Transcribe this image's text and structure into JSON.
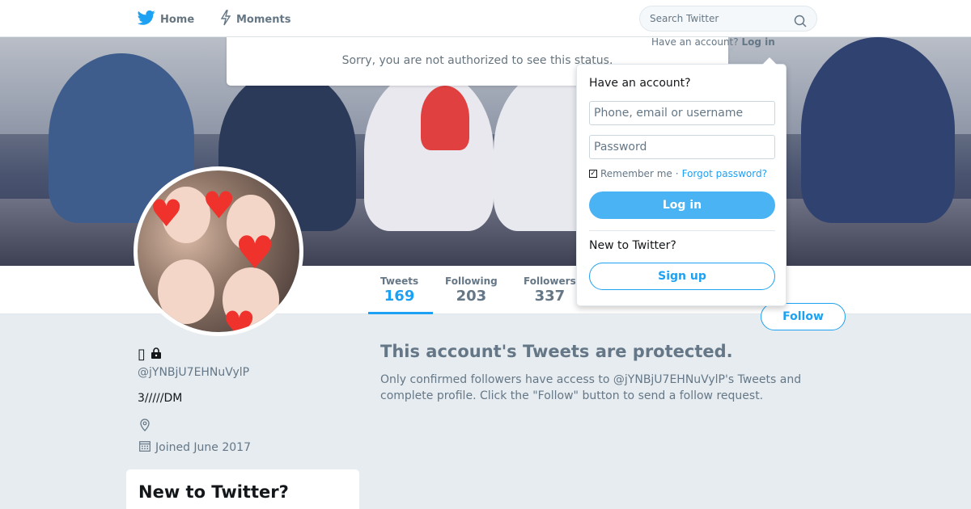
{
  "nav": {
    "home_label": "Home",
    "moments_label": "Moments",
    "search_placeholder": "Search Twitter"
  },
  "error": {
    "message": "Sorry, you are not authorized to see this status."
  },
  "profile": {
    "name_glyphs": "▯",
    "handle": "@jYNBjU7EHNuVylP",
    "bio": "3/////DM",
    "joined": "Joined June 2017",
    "stats": [
      {
        "label": "Tweets",
        "value": "169"
      },
      {
        "label": "Following",
        "value": "203"
      },
      {
        "label": "Followers",
        "value": "337"
      }
    ],
    "follow_label": "Follow"
  },
  "protected": {
    "title": "This account's Tweets are protected.",
    "text": "Only confirmed followers have access to @jYNBjU7EHNuVylP's Tweets and complete profile. Click the \"Follow\" button to send a follow request."
  },
  "sidebar": {
    "signup_heading": "New to Twitter?"
  },
  "login": {
    "have_account_text": "Have an account?",
    "have_account_link": "Log in",
    "heading": "Have an account?",
    "username_placeholder": "Phone, email or username",
    "password_placeholder": "Password",
    "remember_label": "Remember me",
    "separator": "·",
    "forgot_label": "Forgot password?",
    "login_button": "Log in",
    "new_heading": "New to Twitter?",
    "signup_button": "Sign up"
  },
  "colors": {
    "brand": "#1da1f2",
    "background": "#e6ecf0"
  }
}
